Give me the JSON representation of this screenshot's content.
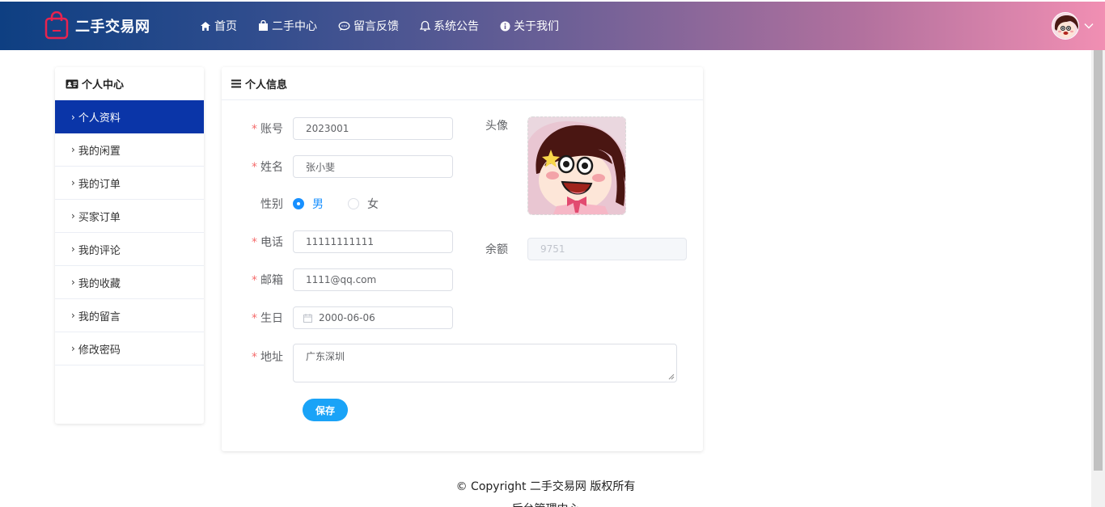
{
  "brand": {
    "name": "二手交易网",
    "logo_icon": "shopping-bag-icon",
    "logo_color": "#e8234f"
  },
  "nav": [
    {
      "label": "首页",
      "icon": "home-icon"
    },
    {
      "label": "二手中心",
      "icon": "bag-icon"
    },
    {
      "label": "留言反馈",
      "icon": "chat-icon"
    },
    {
      "label": "系统公告",
      "icon": "bell-icon"
    },
    {
      "label": "关于我们",
      "icon": "info-icon"
    }
  ],
  "sidebar": {
    "title": "个人中心",
    "items": [
      {
        "label": "个人资料",
        "active": true
      },
      {
        "label": "我的闲置"
      },
      {
        "label": "我的订单"
      },
      {
        "label": "买家订单"
      },
      {
        "label": "我的评论"
      },
      {
        "label": "我的收藏"
      },
      {
        "label": "我的留言"
      },
      {
        "label": "修改密码"
      }
    ],
    "active_color": "#0a35a8"
  },
  "profile": {
    "title": "个人信息",
    "account": {
      "label": "账号",
      "value": "2023001"
    },
    "name": {
      "label": "姓名",
      "value": "张小斐"
    },
    "gender": {
      "label": "性别",
      "options": [
        "男",
        "女"
      ],
      "selected": "男"
    },
    "phone": {
      "label": "电话",
      "value": "11111111111"
    },
    "email": {
      "label": "邮箱",
      "value": "1111@qq.com"
    },
    "birthday": {
      "label": "生日",
      "value": "2000-06-06"
    },
    "address": {
      "label": "地址",
      "value": "广东深圳"
    },
    "avatar_label": "头像",
    "balance": {
      "label": "余额",
      "value": "9751"
    },
    "save_label": "保存"
  },
  "footer": {
    "copyright": "© Copyright 二手交易网 版权所有",
    "admin_link": "后台管理中心"
  }
}
